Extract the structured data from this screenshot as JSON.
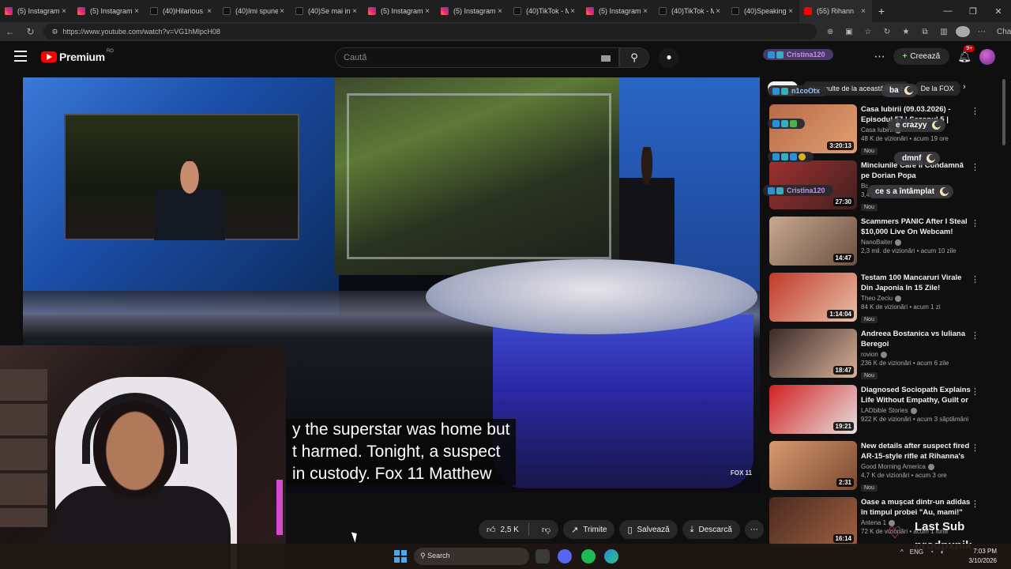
{
  "browser": {
    "tabs": [
      {
        "title": "(5) Instagram",
        "type": "ig"
      },
      {
        "title": "(5) Instagram",
        "type": "ig"
      },
      {
        "title": "(40)Hilarious C",
        "type": "tt"
      },
      {
        "title": "(40)Imi spune s",
        "type": "tt"
      },
      {
        "title": "(40)Se mai inta",
        "type": "tt"
      },
      {
        "title": "(5) Instagram",
        "type": "ig"
      },
      {
        "title": "(5) Instagram",
        "type": "ig"
      },
      {
        "title": "(40)TikTok - Ma",
        "type": "tt"
      },
      {
        "title": "(5) Instagram",
        "type": "ig"
      },
      {
        "title": "(40)TikTok - Ma",
        "type": "tt"
      },
      {
        "title": "(40)Speaking C",
        "type": "tt"
      },
      {
        "title": "(55) Rihann",
        "type": "yt"
      }
    ],
    "url": "https://www.youtube.com/watch?v=VG1hMlpcH08",
    "chat_label": "Chat"
  },
  "youtube": {
    "logo_text": "Premium",
    "logo_country": "RO",
    "search_placeholder": "Caută",
    "create_label": "Creează",
    "notif_count": "9+"
  },
  "video": {
    "caption_lines": [
      "y the superstar was home but",
      "t harmed. Tonight, a suspect",
      " in custody. Fox 11 Matthew"
    ],
    "channel_bug": "FOX 11"
  },
  "actions": {
    "likes": "2,5 K",
    "share": "Trimite",
    "save": "Salvează",
    "download": "Descarcă"
  },
  "chips": [
    "Toate",
    "Mai multe de la această sursă",
    "De la FOX"
  ],
  "chat": {
    "username_top": "Cristina120",
    "users": [
      "n1coOtx",
      "Cristina120"
    ],
    "messages": [
      "ba",
      "e crazyy",
      "dmnf",
      "ce s a întâmplat"
    ]
  },
  "recommendations": [
    {
      "title": "Casa Iubirii (09.03.2026) - Episodul 57 | Sezonul 5 | Editie...",
      "channel": "Casa Iubirii",
      "verified": true,
      "meta": "48 K de vizionări • acum 19 ore",
      "duration": "3:20:13",
      "new": "Nou",
      "thumb": [
        "#b86a4a",
        "#e0a070"
      ]
    },
    {
      "title": "Minciunile Care Îl Condamnă pe Dorian Popa",
      "channel": "Bc",
      "verified": false,
      "meta": "3,4 K de vizionări • acum 10 ore",
      "duration": "27:30",
      "new": "Nou",
      "thumb": [
        "#a03030",
        "#402020"
      ]
    },
    {
      "title": "Scammers PANIC After I Steal $10,000 Live On Webcam!",
      "channel": "NanoBaiter",
      "verified": true,
      "meta": "2,3 mil. de vizionări • acum 10 zile",
      "duration": "14:47",
      "new": "",
      "thumb": [
        "#c8a890",
        "#6a5040"
      ]
    },
    {
      "title": "Testam 100 Mancaruri Virale Din Japonia In 15 Zile! (Japoni...",
      "channel": "Theo Zeciu",
      "verified": true,
      "meta": "84 K de vizionări • acum 1 zi",
      "duration": "1:14:04",
      "new": "Nou",
      "thumb": [
        "#c03a2a",
        "#e8c0a8"
      ]
    },
    {
      "title": "Andreea Bostanica vs Iuliana Beregoi",
      "channel": "rovion",
      "verified": true,
      "meta": "236 K de vizionări • acum 6 zile",
      "duration": "18:47",
      "new": "Nou",
      "thumb": [
        "#3a2a28",
        "#d8b098"
      ]
    },
    {
      "title": "Diagnosed Sociopath Explains Life Without Empathy, Guilt or ...",
      "channel": "LADbible Stories",
      "verified": true,
      "meta": "922 K de vizionări • acum 3 săptămâni",
      "duration": "19:21",
      "new": "",
      "thumb": [
        "#d02020",
        "#e8e0e0"
      ]
    },
    {
      "title": "New details after suspect fired AR-15-style rifle at Rihanna's ...",
      "channel": "Good Morning America",
      "verified": true,
      "meta": "4,7 K de vizionări • acum 3 ore",
      "duration": "2:31",
      "new": "Nou",
      "thumb": [
        "#d89a70",
        "#7a4a30"
      ]
    },
    {
      "title": "Oase a mușcat dintr-un adidas în timpul probei \"Au, mami!\"",
      "channel": "Antena 1",
      "verified": true,
      "meta": "72 K de vizionări • acum 1 lună",
      "duration": "16:14",
      "new": "",
      "thumb": [
        "#4a2a20",
        "#a06040"
      ]
    }
  ],
  "overlay": {
    "sub_title": "Last Sub",
    "sub_name": "prodpxnik"
  },
  "taskbar": {
    "search": "Search",
    "lang": "ENG",
    "time": "7:03 PM",
    "date": "3/10/2026"
  }
}
